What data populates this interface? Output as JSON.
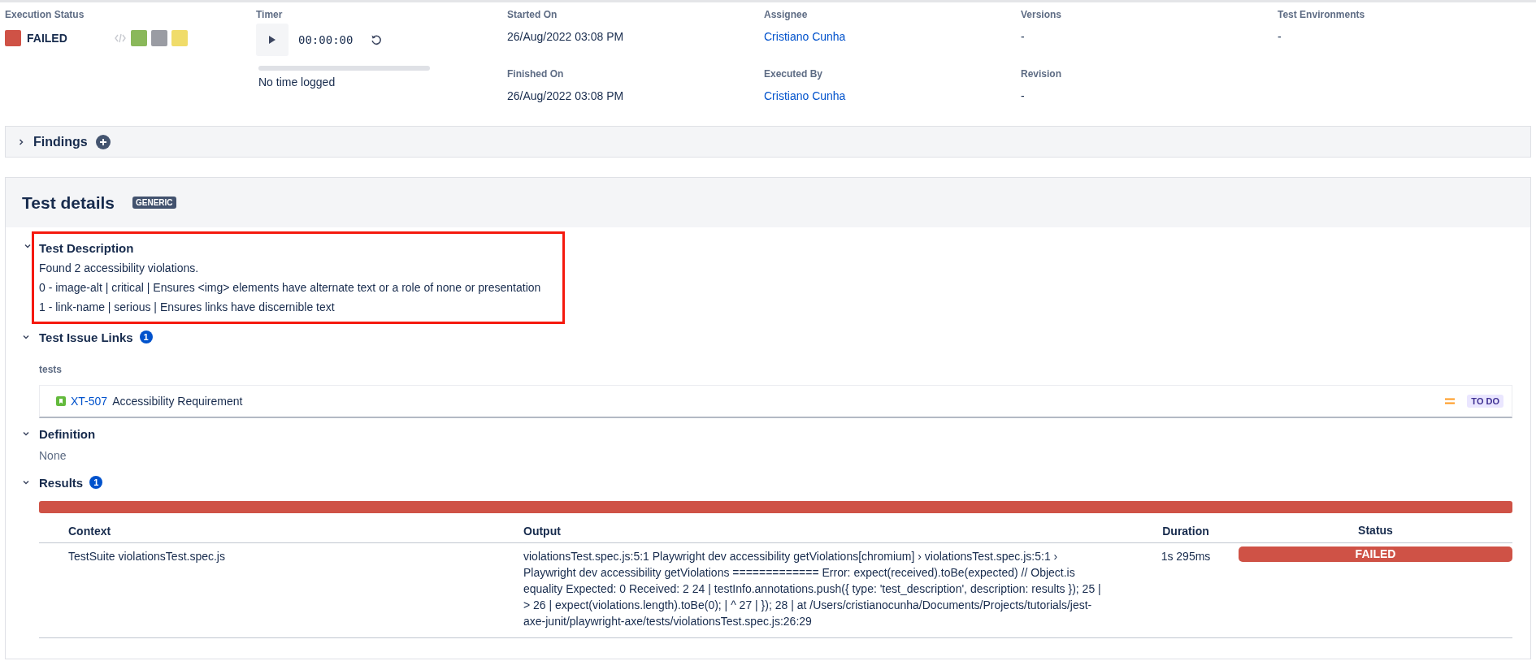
{
  "summary": {
    "execution_status": {
      "label": "Execution Status",
      "value": "FAILED",
      "color": "#cf5246",
      "options": [
        {
          "color": "#8ab85a"
        },
        {
          "color": "#9a9ca3"
        },
        {
          "color": "#f0dc6a"
        }
      ]
    },
    "timer": {
      "label": "Timer",
      "time": "00:00:00",
      "level": 0,
      "logged": "No time logged"
    },
    "fields": [
      {
        "label": "Started On",
        "value": "26/Aug/2022 03:08 PM",
        "kind": "text"
      },
      {
        "label": "Assignee",
        "value": "Cristiano Cunha",
        "kind": "link"
      },
      {
        "label": "Versions",
        "value": "-",
        "kind": "text"
      },
      {
        "label": "Test Environments",
        "value": "-",
        "kind": "text"
      },
      {
        "label": "Finished On",
        "value": "26/Aug/2022 03:08 PM",
        "kind": "text"
      },
      {
        "label": "Executed By",
        "value": "Cristiano Cunha",
        "kind": "link"
      },
      {
        "label": "Revision",
        "value": "-",
        "kind": "text"
      }
    ]
  },
  "findings": {
    "title": "Findings",
    "expanded": false
  },
  "test_details": {
    "title": "Test details",
    "badge": "GENERIC",
    "description": {
      "title": "Test Description",
      "expanded": true,
      "highlighted": true,
      "lines": [
        "Found 2 accessibility violations.",
        "0 - image-alt | critical | Ensures <img> elements have alternate text or a role of none or presentation",
        "1 - link-name | serious | Ensures links have discernible text"
      ]
    },
    "issue_links": {
      "title": "Test Issue Links",
      "expanded": true,
      "count": "1",
      "group": "tests",
      "items": [
        {
          "key": "XT-507",
          "summary": "Accessibility Requirement",
          "status": "TO DO"
        }
      ]
    },
    "definition": {
      "title": "Definition",
      "expanded": true,
      "value": "None"
    },
    "results": {
      "title": "Results",
      "expanded": true,
      "count": "1",
      "color": "#cf5246",
      "level": 1,
      "columns": [
        "Context",
        "Output",
        "Duration",
        "Status"
      ],
      "rows": [
        {
          "context": "TestSuite violationsTest.spec.js",
          "output": "violationsTest.spec.js:5:1 Playwright dev accessibility getViolations[chromium] › violationsTest.spec.js:5:1 › Playwright dev accessibility getViolations ============= Error: expect(received).toBe(expected) // Object.is equality Expected: 0 Received: 2 24 | testInfo.annotations.push({ type: 'test_description', description: results }); 25 | > 26 | expect(violations.length).toBe(0); | ^ 27 | }); 28 | at /Users/cristianocunha/Documents/Projects/tutorials/jest-axe-junit/playwright-axe/tests/violationsTest.spec.js:26:29",
          "duration": "1s 295ms",
          "status": "FAILED",
          "color": "#cf5246"
        }
      ]
    }
  }
}
